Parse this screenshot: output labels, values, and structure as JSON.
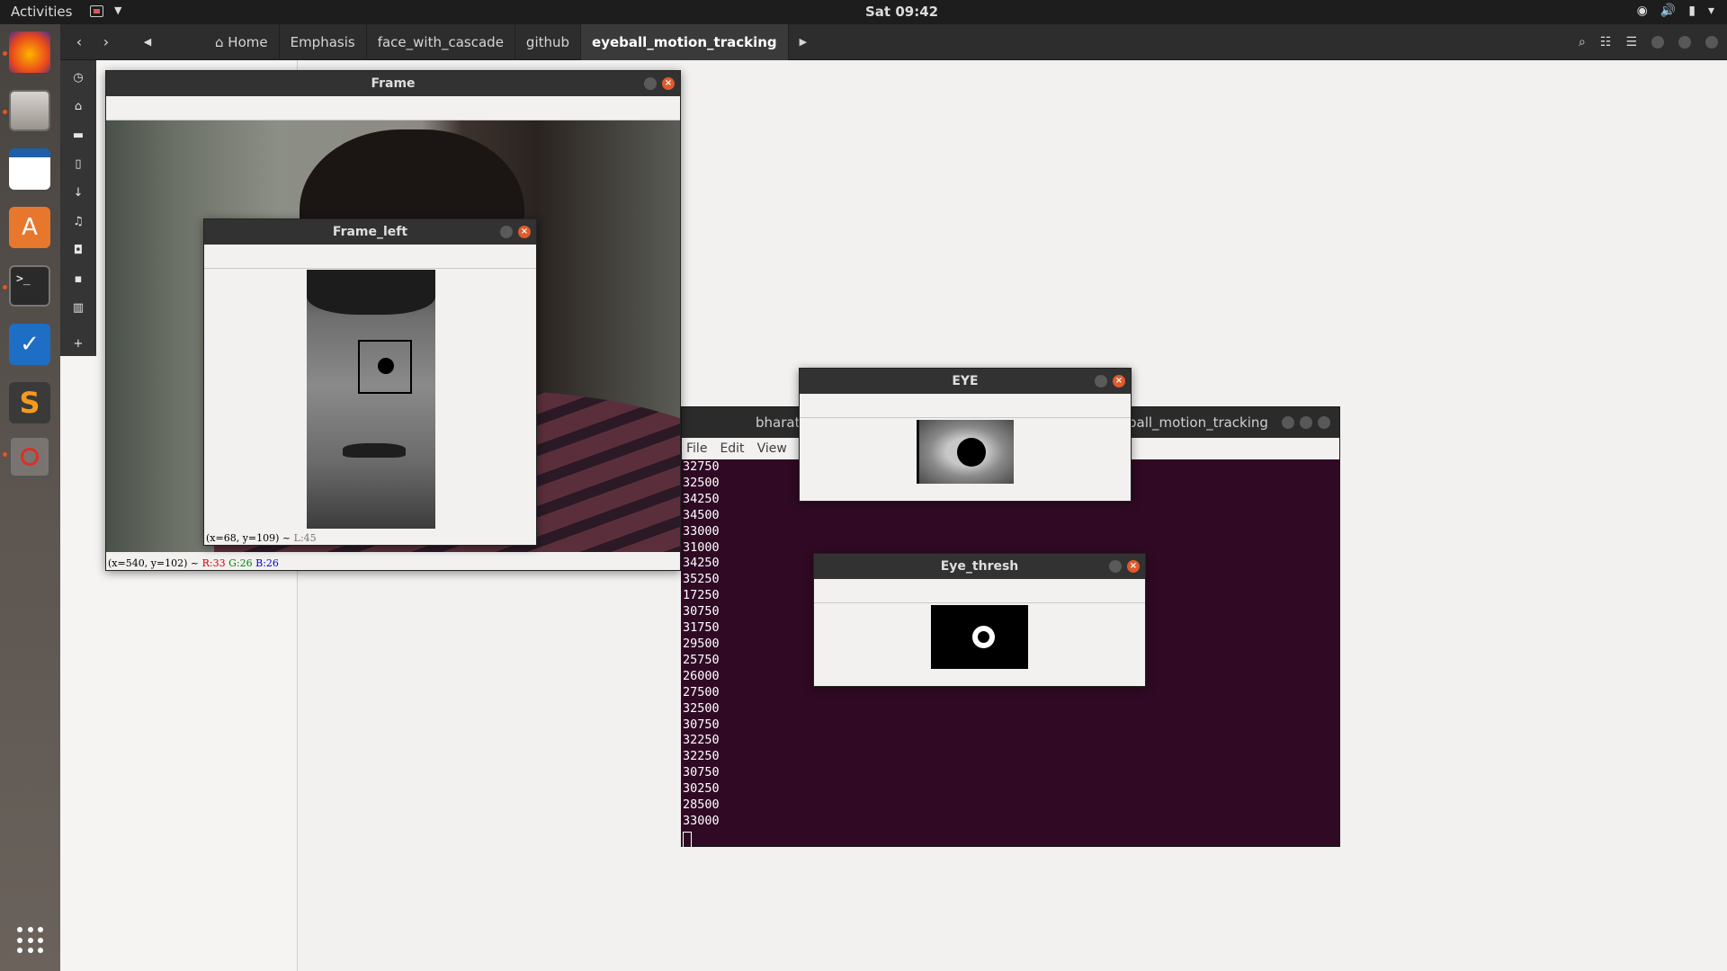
{
  "topbar": {
    "activities": "Activities",
    "clock": "Sat 09:42"
  },
  "dock": {
    "apps": [
      "firefox-icon",
      "files-icon",
      "writer-icon",
      "software-icon",
      "terminal-icon",
      "todo-icon",
      "sublime-icon",
      "python-frame-icon"
    ],
    "show_apps": "show-applications-icon"
  },
  "nautilus": {
    "breadcrumbs": [
      "Home",
      "Emphasis",
      "face_with_cascade",
      "github",
      "eyeball_motion_tracking"
    ],
    "active_crumb": "eyeball_motion_tracking"
  },
  "windows": {
    "frame": {
      "title": "Frame",
      "status_coords": "(x=540, y=102) ~",
      "status_r": "R:33",
      "status_g": "G:26",
      "status_b": "B:26"
    },
    "frame_left": {
      "title": "Frame_left",
      "status": "(x=68, y=109) ~",
      "status_l": "L:45"
    },
    "eye": {
      "title": "EYE"
    },
    "eye_thresh": {
      "title": "Eye_thresh"
    }
  },
  "terminal": {
    "title_left": "bharat",
    "title_right": "ball_motion_tracking",
    "menu": [
      "File",
      "Edit",
      "View",
      "S"
    ],
    "lines": [
      "32750",
      "32500",
      "34250",
      "34500",
      "33000",
      "31000",
      "34250",
      "35250",
      "17250",
      "30750",
      "31750",
      "29500",
      "25750",
      "26000",
      "27500",
      "32500",
      "30750",
      "32250",
      "32250",
      "30750",
      "30250",
      "28500",
      "33000"
    ]
  }
}
